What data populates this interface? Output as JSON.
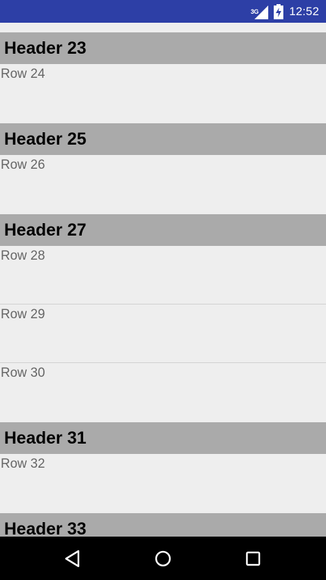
{
  "status_bar": {
    "network_type": "3G",
    "time": "12:52",
    "icons": [
      "signal-icon",
      "battery-charging-icon"
    ]
  },
  "list": {
    "headers": {
      "h23": "Header 23",
      "h25": "Header 25",
      "h27": "Header 27",
      "h31": "Header 31",
      "h33": "Header 33"
    },
    "rows": {
      "r24": "Row 24",
      "r26": "Row 26",
      "r28": "Row 28",
      "r29": "Row 29",
      "r30": "Row 30",
      "r32": "Row 32"
    }
  },
  "navigation_bar": {
    "buttons": [
      "back-icon",
      "home-icon",
      "recents-icon"
    ]
  },
  "colors": {
    "status_bar": "#2d3fa6",
    "header_background": "#aaaaaa",
    "list_background": "#eeeeee",
    "row_text": "#666666",
    "nav_bar": "#000000"
  }
}
